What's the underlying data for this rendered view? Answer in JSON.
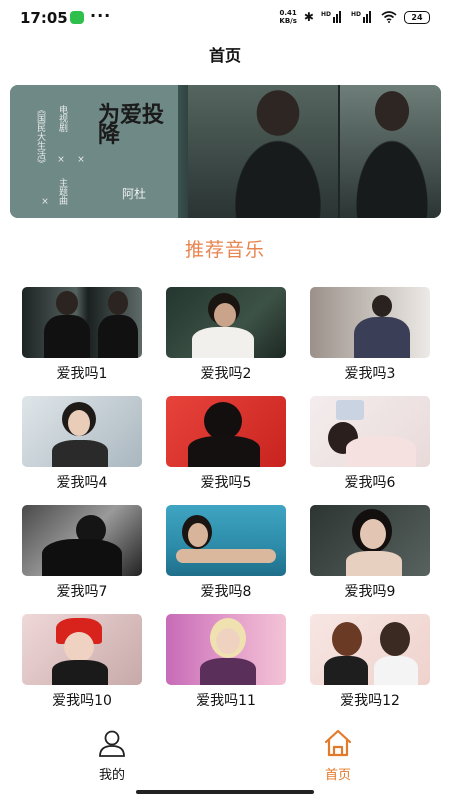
{
  "status_bar": {
    "time": "17:05",
    "network_speed": "0.41",
    "network_unit": "KB/s",
    "sim1": "HD",
    "sim2": "HD",
    "battery": "24",
    "icons": [
      "wechat-icon",
      "more-icon",
      "bluetooth-icon",
      "signal-icon",
      "signal-icon",
      "wifi-icon",
      "battery-icon"
    ]
  },
  "header": {
    "title": "首页"
  },
  "banner": {
    "line1": "《国民大生活》",
    "line2": "电视剧",
    "line3": "主题曲",
    "song_title": "为爱投降",
    "artist": "阿杜",
    "marks": [
      "×",
      "×",
      "×"
    ]
  },
  "section": {
    "title": "推荐音乐"
  },
  "songs": [
    {
      "label": "爱我吗1"
    },
    {
      "label": "爱我吗2"
    },
    {
      "label": "爱我吗3"
    },
    {
      "label": "爱我吗4"
    },
    {
      "label": "爱我吗5"
    },
    {
      "label": "爱我吗6"
    },
    {
      "label": "爱我吗7"
    },
    {
      "label": "爱我吗8"
    },
    {
      "label": "爱我吗9"
    },
    {
      "label": "爱我吗10"
    },
    {
      "label": "爱我吗11"
    },
    {
      "label": "爱我吗12"
    }
  ],
  "bottom_nav": {
    "mine": {
      "label": "我的",
      "icon": "user-icon"
    },
    "home": {
      "label": "首页",
      "icon": "home-icon",
      "active": true
    }
  },
  "colors": {
    "accent": "#e37a2a",
    "section_title": "#e8844f"
  }
}
